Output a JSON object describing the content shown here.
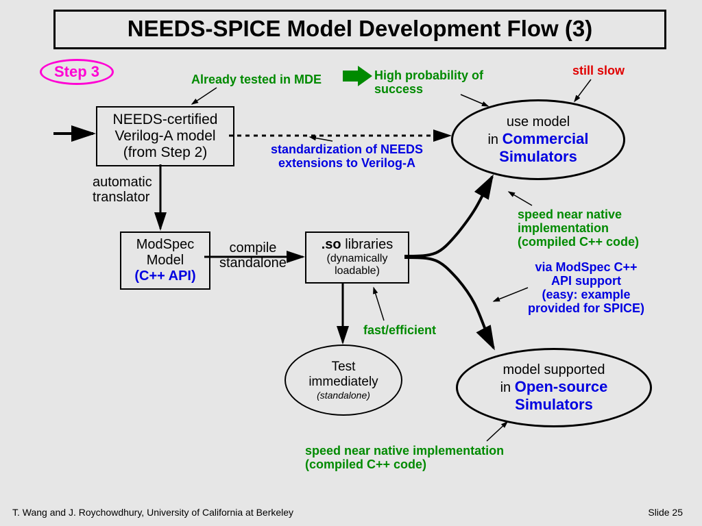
{
  "title": "NEEDS-SPICE Model Development Flow (3)",
  "step_badge": "Step 3",
  "boxes": {
    "needs_certified": {
      "l1": "NEEDS-certified",
      "l2": "Verilog-A model",
      "l3": "(from Step 2)"
    },
    "modspec": {
      "l1": "ModSpec",
      "l2": "Model",
      "l3": "(C++ API)"
    },
    "so_libs": {
      "l1_pre": ".so",
      "l1_post": " libraries",
      "l2": "(dynamically",
      "l3": "loadable)"
    }
  },
  "ellipses": {
    "commercial": {
      "l1": "use model",
      "l2_pre": "in ",
      "l2_em": "Commercial",
      "l3_em": "Simulators"
    },
    "test": {
      "l1": "Test",
      "l2": "immediately",
      "l3": "(standalone)"
    },
    "opensource": {
      "l1": "model supported",
      "l2_pre": "in ",
      "l2_em": "Open-source",
      "l3_em": "Simulators"
    }
  },
  "labels": {
    "already_tested": "Already tested in MDE",
    "high_prob": "High probability of\nsuccess",
    "still_slow": "still slow",
    "standardization": "standardization of NEEDS\nextensions to Verilog-A",
    "auto_translator": "automatic\ntranslator",
    "compile": "compile\nstandalone",
    "fast_efficient": "fast/efficient",
    "speed_near_top": "speed near native\nimplementation\n(compiled C++ code)",
    "via_modspec": "via ModSpec C++\nAPI support\n(easy: example\nprovided for SPICE)",
    "speed_near_bottom": "speed near native implementation\n(compiled C++ code)"
  },
  "footer": {
    "left": "T. Wang and J. Roychowdhury, University of California at Berkeley",
    "right": "Slide 25"
  }
}
